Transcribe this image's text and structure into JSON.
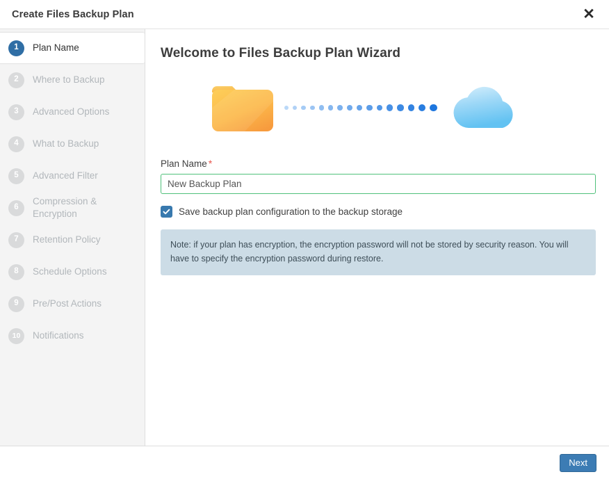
{
  "window": {
    "title": "Create Files Backup Plan",
    "close_icon": "close-icon",
    "close_glyph": "✕"
  },
  "sidebar": {
    "steps": [
      {
        "number": "1",
        "label": "Plan Name",
        "active": true
      },
      {
        "number": "2",
        "label": "Where to Backup",
        "active": false
      },
      {
        "number": "3",
        "label": "Advanced Options",
        "active": false
      },
      {
        "number": "4",
        "label": "What to Backup",
        "active": false
      },
      {
        "number": "5",
        "label": "Advanced Filter",
        "active": false
      },
      {
        "number": "6",
        "label": "Compression & Encryption",
        "active": false
      },
      {
        "number": "7",
        "label": "Retention Policy",
        "active": false
      },
      {
        "number": "8",
        "label": "Schedule Options",
        "active": false
      },
      {
        "number": "9",
        "label": "Pre/Post Actions",
        "active": false
      },
      {
        "number": "10",
        "label": "Notifications",
        "active": false
      }
    ]
  },
  "main": {
    "heading": "Welcome to Files Backup Plan Wizard",
    "illustration": {
      "folder_icon": "folder-icon",
      "cloud_icon": "cloud-icon",
      "transfer_dots_icon": "transfer-dots-icon",
      "dot_count": 16
    },
    "plan_name": {
      "label": "Plan Name",
      "required_marker": "*",
      "value": "New Backup Plan",
      "placeholder": "New Backup Plan"
    },
    "save_config_checkbox": {
      "label": "Save backup plan configuration to the backup storage",
      "checked": true
    },
    "note": "Note: if your plan has encryption, the encryption password will not be stored by security reason. You will have to specify the encryption password during restore."
  },
  "footer": {
    "next_label": "Next"
  },
  "colors": {
    "accent_blue": "#3c7cb4",
    "active_badge": "#2f6ea5",
    "inactive_badge": "#d9dadb",
    "input_border_green": "#4fc17a",
    "note_bg": "#ccdce6",
    "required_red": "#e8554c",
    "folder_orange": "#f7a83b",
    "cloud_blue": "#8dd0f5",
    "sidebar_bg": "#f4f4f4"
  }
}
